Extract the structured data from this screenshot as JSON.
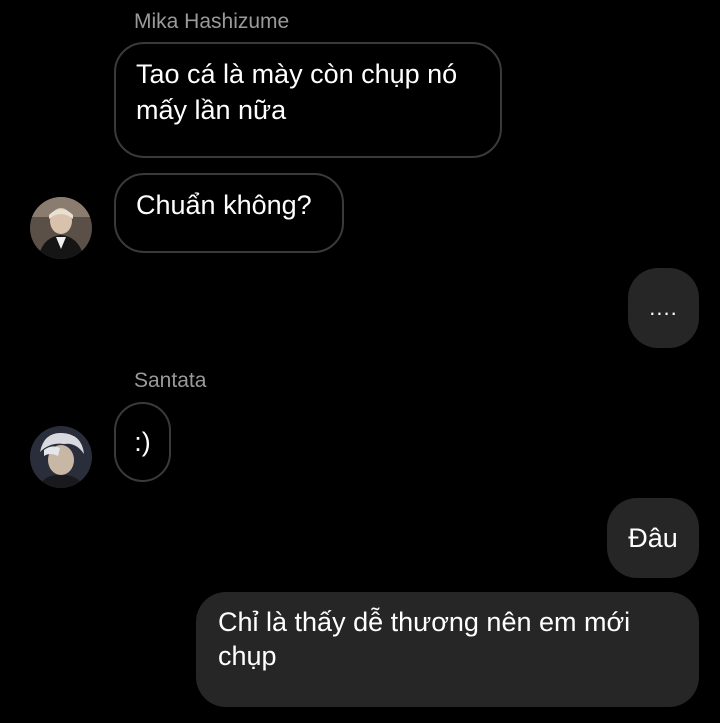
{
  "conversation": {
    "messages": [
      {
        "sender": "Mika Hashizume",
        "text": "Tao cá là mày còn chụp nó mấy lần nữa",
        "direction": "incoming"
      },
      {
        "sender": "Mika Hashizume",
        "text": "Chuẩn không?",
        "direction": "incoming"
      },
      {
        "text": "....",
        "direction": "outgoing"
      },
      {
        "sender": "Santata",
        "text": ":)",
        "direction": "incoming"
      },
      {
        "text": "Đâu",
        "direction": "outgoing"
      },
      {
        "text": "Chỉ là thấy dễ thương nên em mới chụp",
        "direction": "outgoing"
      }
    ]
  },
  "colors": {
    "background": "#000000",
    "incoming_border": "#3a3a3a",
    "outgoing_bubble": "#262626",
    "sender_name": "#9a9a9a"
  }
}
